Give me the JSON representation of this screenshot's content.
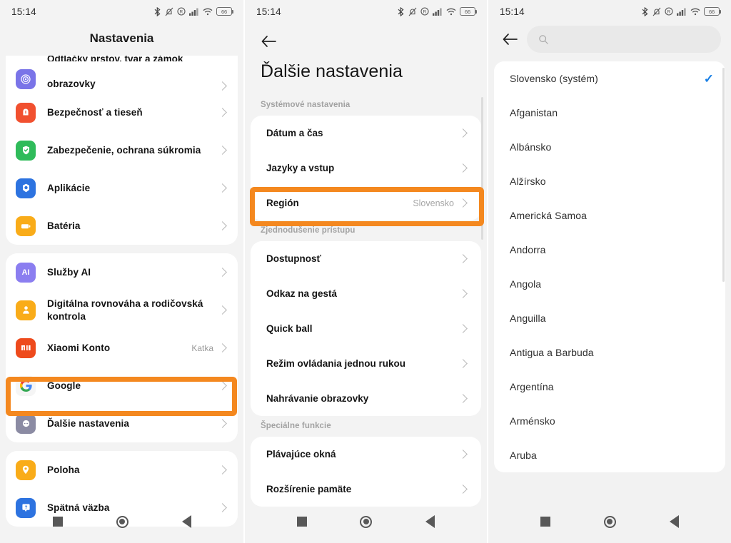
{
  "status_bar": {
    "time": "15:14",
    "battery_level": "66",
    "icons": [
      "bluetooth-icon",
      "mute-bell-icon",
      "dnd-icon",
      "signal-icon",
      "wifi-icon",
      "battery-icon"
    ]
  },
  "colors": {
    "highlight": "#f4881f",
    "check": "#1a80e5",
    "page_bg": "#f3f3f3",
    "card_bg": "#ffffff"
  },
  "panel1": {
    "title": "Nastavenia",
    "groups": [
      {
        "clipped": true,
        "items": [
          {
            "label": "obrazovky",
            "clipped_label": "Odtlačky prstov, tvar a zámok",
            "icon": "fingerprint-icon",
            "icon_color": "#7a74e8",
            "value": ""
          },
          {
            "label": "Bezpečnosť a tieseň",
            "icon": "emergency-icon",
            "icon_color": "#f1502f",
            "value": ""
          },
          {
            "label": "Zabezpečenie, ochrana súkromia",
            "icon": "shield-check-icon",
            "icon_color": "#2fbb5a",
            "value": ""
          },
          {
            "label": "Aplikácie",
            "icon": "apps-icon",
            "icon_color": "#2d73e0",
            "value": ""
          },
          {
            "label": "Batéria",
            "icon": "battery-icon",
            "icon_color": "#f9ac19",
            "value": ""
          }
        ]
      },
      {
        "clipped": false,
        "items": [
          {
            "label": "Služby AI",
            "icon": "ai-icon",
            "icon_color": "#8b7ef0",
            "value": ""
          },
          {
            "label": "Digitálna rovnováha a rodičovská kontrola",
            "icon": "parental-control-icon",
            "icon_color": "#f9ac19",
            "value": ""
          },
          {
            "label": "Xiaomi Konto",
            "icon": "xiaomi-icon",
            "icon_color": "#ee4a1c",
            "value": "Katka"
          },
          {
            "label": "Google",
            "icon": "google-icon",
            "icon_color": "#f5f5f5",
            "value": ""
          },
          {
            "label": "Ďalšie nastavenia",
            "icon": "more-settings-icon",
            "icon_color": "#8b8ba3",
            "value": "",
            "highlighted": true
          }
        ]
      },
      {
        "clipped": false,
        "items": [
          {
            "label": "Poloha",
            "icon": "location-pin-icon",
            "icon_color": "#f9ac19",
            "value": ""
          },
          {
            "label": "Spätná väzba",
            "icon": "feedback-icon",
            "icon_color": "#2d73e0",
            "value": ""
          }
        ]
      }
    ]
  },
  "panel2": {
    "back_label": "back-arrow",
    "title": "Ďalšie nastavenia",
    "groups": [
      {
        "header": "Systémové nastavenia",
        "items": [
          {
            "label": "Dátum a čas",
            "value": ""
          },
          {
            "label": "Jazyky a vstup",
            "value": ""
          },
          {
            "label": "Región",
            "value": "Slovensko",
            "highlighted": true
          }
        ]
      },
      {
        "header": "Zjednodušenie prístupu",
        "items": [
          {
            "label": "Dostupnosť",
            "value": ""
          },
          {
            "label": "Odkaz na gestá",
            "value": ""
          },
          {
            "label": "Quick ball",
            "value": ""
          },
          {
            "label": "Režim ovládania jednou rukou",
            "value": ""
          },
          {
            "label": "Nahrávanie obrazovky",
            "value": ""
          }
        ]
      },
      {
        "header": "Špeciálne funkcie",
        "items": [
          {
            "label": "Plávajúce okná",
            "value": ""
          },
          {
            "label": "Rozšírenie pamäte",
            "value": ""
          }
        ]
      }
    ]
  },
  "panel3": {
    "back_label": "back-arrow",
    "search_placeholder": "",
    "search_value": "",
    "items": [
      {
        "label": "Slovensko (systém)",
        "selected": true
      },
      {
        "label": "Afganistan",
        "selected": false
      },
      {
        "label": "Albánsko",
        "selected": false
      },
      {
        "label": "Alžírsko",
        "selected": false
      },
      {
        "label": "Americká Samoa",
        "selected": false
      },
      {
        "label": "Andorra",
        "selected": false
      },
      {
        "label": "Angola",
        "selected": false
      },
      {
        "label": "Anguilla",
        "selected": false
      },
      {
        "label": "Antigua a Barbuda",
        "selected": false
      },
      {
        "label": "Argentína",
        "selected": false
      },
      {
        "label": "Arménsko",
        "selected": false
      },
      {
        "label": "Aruba",
        "selected": false
      }
    ]
  },
  "navbar": {
    "recents": "recents-square-icon",
    "home": "home-circle-icon",
    "back": "back-triangle-icon"
  }
}
